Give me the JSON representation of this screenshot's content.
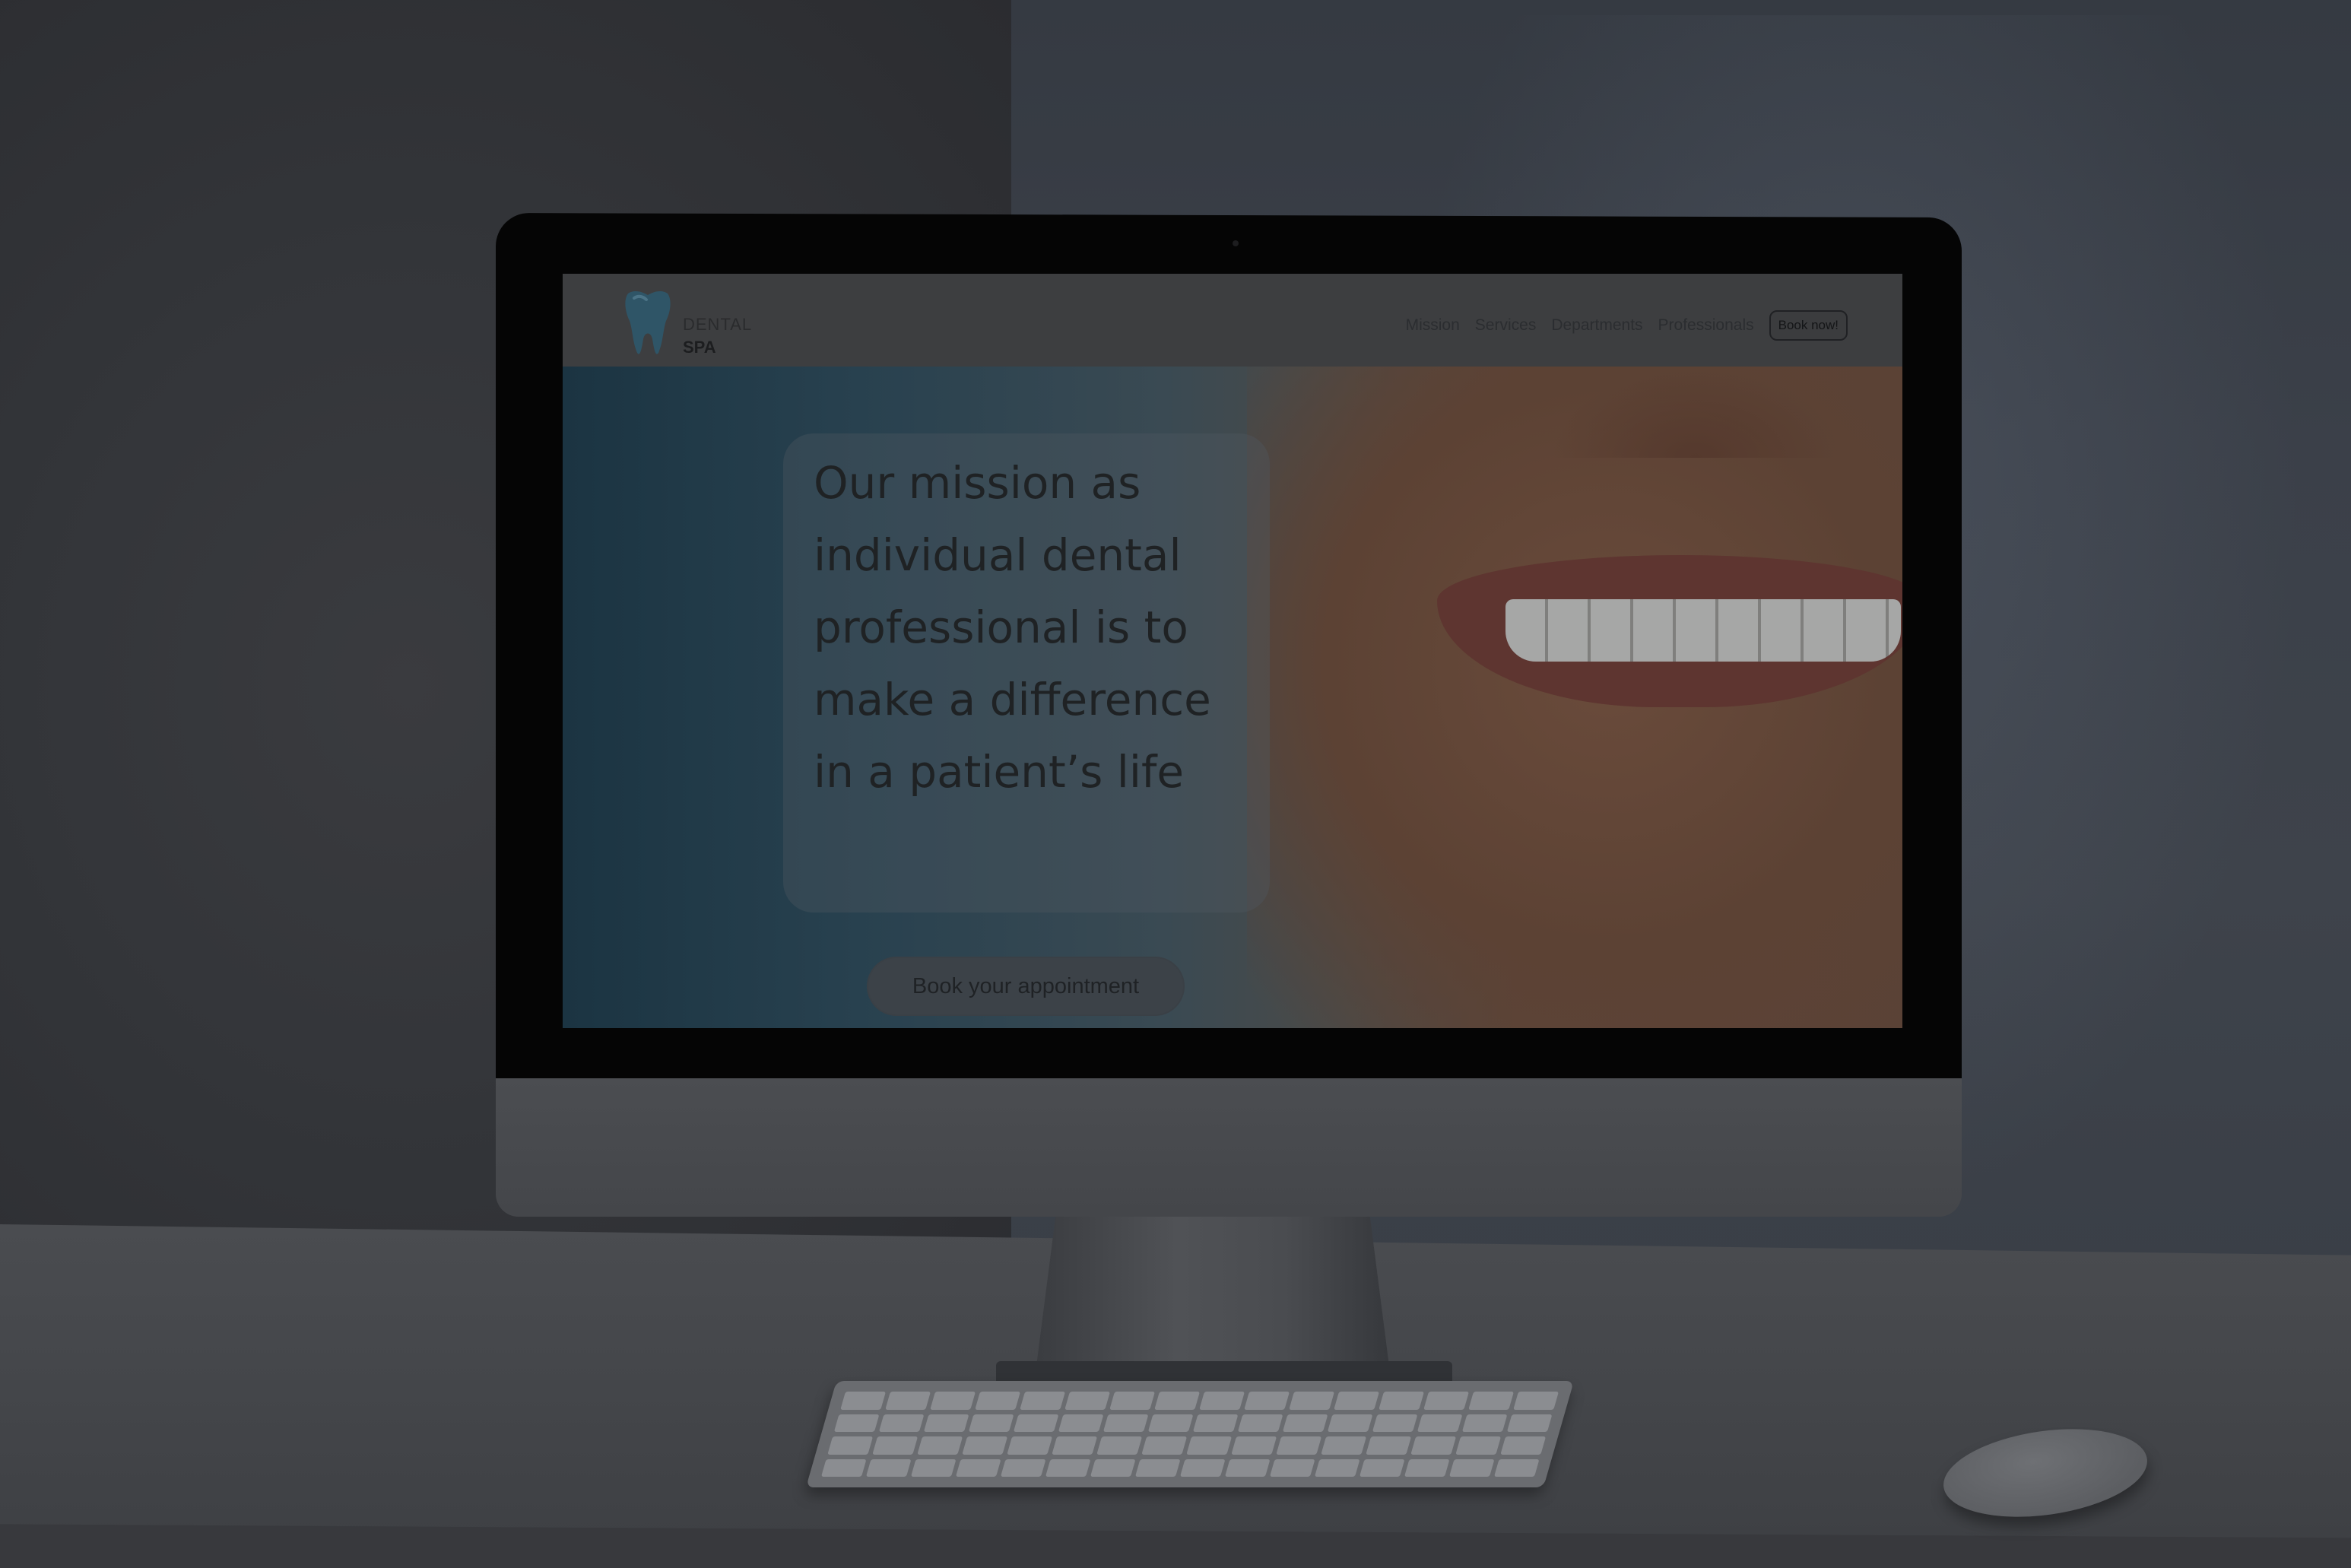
{
  "logo": {
    "line1": "DENTAL",
    "line2": "SPA",
    "icon": "tooth-icon"
  },
  "nav": {
    "items": [
      {
        "label": "Mission"
      },
      {
        "label": "Services"
      },
      {
        "label": "Departments"
      },
      {
        "label": "Professionals"
      }
    ],
    "cta_label": "Book now!"
  },
  "hero": {
    "heading": "Our mission as individual dental professional is to make a difference in a patient’s life",
    "button_label": "Book your appointment"
  },
  "colors": {
    "hero_left": "#1b3442",
    "hero_right": "#5a4236",
    "page_dim": "#2e3034"
  }
}
